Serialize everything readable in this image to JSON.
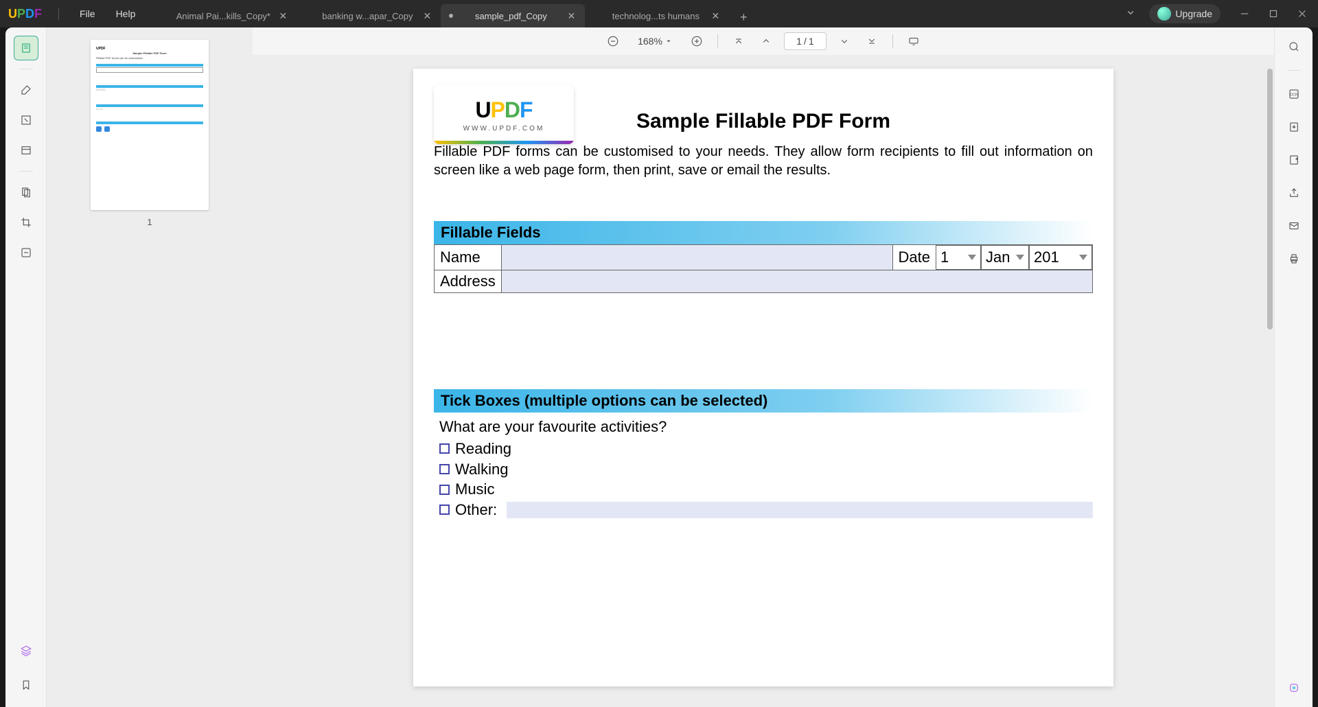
{
  "titlebar": {
    "logo": {
      "u": "U",
      "p": "P",
      "d": "D",
      "f": "F"
    },
    "menu": {
      "file": "File",
      "help": "Help"
    },
    "tabs": [
      {
        "label": "Animal Pai...kills_Copy*",
        "active": false
      },
      {
        "label": "banking w...apar_Copy",
        "active": false
      },
      {
        "label": "sample_pdf_Copy",
        "active": true
      },
      {
        "label": "technolog...ts humans",
        "active": false
      }
    ],
    "upgrade": "Upgrade"
  },
  "toolbar": {
    "zoom": "168%",
    "page_current": "1",
    "page_sep": "/",
    "page_total": "1"
  },
  "thumbnail": {
    "page_num": "1"
  },
  "doc": {
    "brand": {
      "logo": "UPDF",
      "url": "WWW.UPDF.COM"
    },
    "title": "Sample Fillable PDF Form",
    "intro": "Fillable PDF forms can be customised to your needs. They allow form recipients to fill out information on screen like a web page form, then print, save or email the results.",
    "sections": {
      "fillable": {
        "header": "Fillable Fields",
        "name_label": "Name",
        "date_label": "Date",
        "date_day": "1",
        "date_month": "Jan",
        "date_year": "201",
        "address_label": "Address"
      },
      "tickboxes": {
        "header": "Tick Boxes (multiple options can be selected)",
        "question": "What are your favourite activities?",
        "options": [
          "Reading",
          "Walking",
          "Music",
          "Other:"
        ]
      }
    }
  }
}
